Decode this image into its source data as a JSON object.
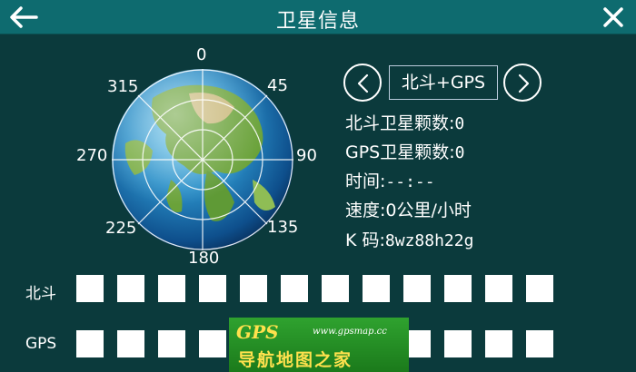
{
  "header": {
    "title": "卫星信息",
    "back_icon": "arrow-left-icon",
    "close_icon": "close-icon"
  },
  "compass": {
    "labels": {
      "d0": "0",
      "d45": "45",
      "d90": "90",
      "d135": "135",
      "d180": "180",
      "d225": "225",
      "d270": "270",
      "d315": "315"
    }
  },
  "mode": {
    "prev_icon": "chevron-left-icon",
    "next_icon": "chevron-right-icon",
    "value": "北斗+GPS"
  },
  "info": {
    "beidou_count_label": "北斗卫星颗数:",
    "beidou_count": "0",
    "gps_count_label": "GPS卫星颗数:",
    "gps_count": "0",
    "time_label": "时间:",
    "time_value": "--:--",
    "speed_label": "速度:",
    "speed_value": "0公里/小时",
    "k_label": "K 码:",
    "k_value": "8wz88h22g"
  },
  "signals": {
    "beidou_label": "北斗",
    "gps_label": "GPS"
  },
  "watermark": {
    "logo": "GPS",
    "url": "www.gpsmap.cc",
    "subtitle": "导航地图之家"
  },
  "colors": {
    "background": "#0b3a3c",
    "titlebar": "#0e6b6f",
    "text": "#ffffff"
  }
}
